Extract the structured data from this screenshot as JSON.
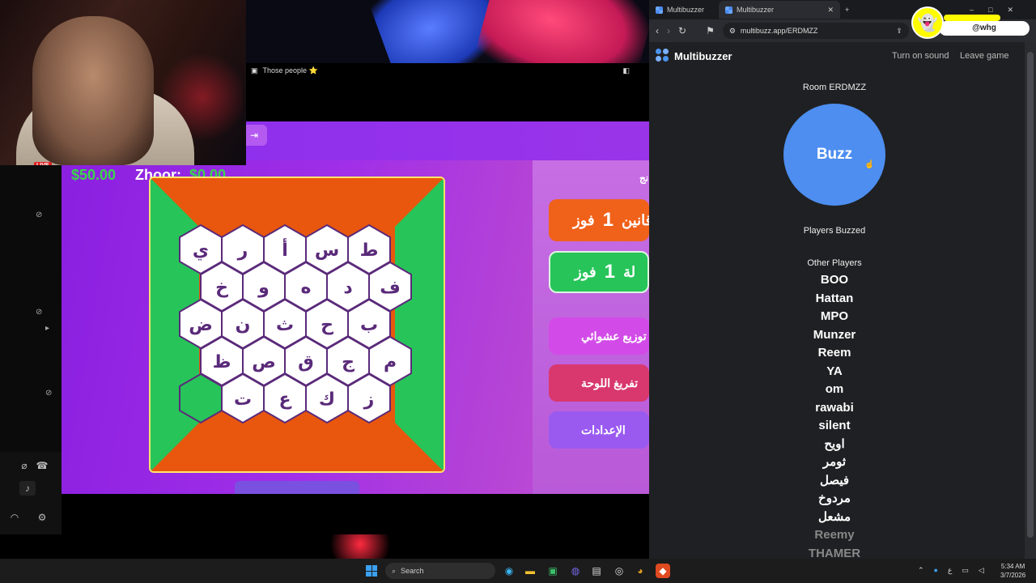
{
  "stream": {
    "live_label": "LIVE",
    "toolbar_title": "Those people ⭐",
    "score_left": "$50.00",
    "score_name": "Zhoor:",
    "score_right": "$0.00"
  },
  "game": {
    "heading": "نج",
    "team_orange": {
      "prefix": "فوز",
      "count": "1",
      "suffix": "قانين"
    },
    "team_green": {
      "prefix": "فوز",
      "count": "1",
      "suffix": "لة"
    },
    "btn_random": "توزيع عشوائي",
    "btn_clear": "تفريغ اللوحة",
    "btn_settings": "الإعدادات",
    "letters_rows": [
      [
        "ي",
        "ر",
        "أ",
        "س",
        "ط"
      ],
      [
        "خ",
        "و",
        "ه",
        "د",
        "ف"
      ],
      [
        "ض",
        "ن",
        "ث",
        "ح",
        "ب"
      ],
      [
        "ظ",
        "ص",
        "ق",
        "ج",
        "م"
      ],
      [
        "",
        "ت",
        "ع",
        "ك",
        "ز"
      ]
    ],
    "colors": {
      "orange": "#e8570d",
      "green": "#27c45a",
      "purple": "#5a2a7a"
    }
  },
  "browser": {
    "tab1": "Multibuzzer",
    "tab2": "Multibuzzer",
    "url": "multibuzz.app/ERDMZZ",
    "snap_handle": "@whg"
  },
  "multibuzzer": {
    "title": "Multibuzzer",
    "sound_link": "Turn on sound",
    "leave_link": "Leave game",
    "room": "Room ERDMZZ",
    "buzz_label": "Buzz",
    "players_buzzed": "Players Buzzed",
    "other_players": "Other Players",
    "players": [
      "BOO",
      "Hattan",
      "MPO",
      "Munzer",
      "Reem",
      "YA",
      "om",
      "rawabi",
      "silent",
      "اويح",
      "ثومر",
      "فيصل",
      "مردوخ",
      "مشعل"
    ],
    "dim_players": [
      "Reemy",
      "THAMER"
    ]
  },
  "taskbar": {
    "search": "Search",
    "time": "5:34 AM",
    "date": "3/7/2026"
  }
}
